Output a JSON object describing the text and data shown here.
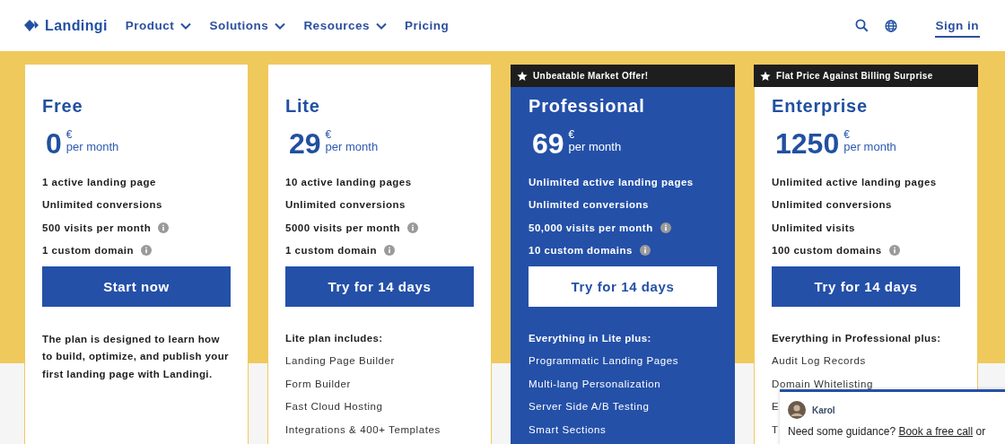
{
  "header": {
    "logo": "Landingi",
    "nav": [
      {
        "label": "Product",
        "dropdown": true
      },
      {
        "label": "Solutions",
        "dropdown": true
      },
      {
        "label": "Resources",
        "dropdown": true
      },
      {
        "label": "Pricing",
        "dropdown": false
      }
    ],
    "sign_in": "Sign in"
  },
  "plans": [
    {
      "name": "Free",
      "highlighted": false,
      "price": "0",
      "currency": "€",
      "period": "per month",
      "features": [
        {
          "text": "1 active landing page",
          "info": false
        },
        {
          "text": "Unlimited conversions",
          "info": false
        },
        {
          "text": "500 visits per month",
          "info": true
        },
        {
          "text": "1 custom domain",
          "info": true
        }
      ],
      "button": "Start now",
      "description": "The plan is designed to learn how to build, optimize, and publish your first landing page with Landingi."
    },
    {
      "name": "Lite",
      "highlighted": false,
      "price": "29",
      "currency": "€",
      "period": "per month",
      "features": [
        {
          "text": "10 active landing pages",
          "info": false
        },
        {
          "text": "Unlimited conversions",
          "info": false
        },
        {
          "text": "5000 visits per month",
          "info": true
        },
        {
          "text": "1 custom domain",
          "info": true
        }
      ],
      "button": "Try for 14 days",
      "includes_heading": "Lite plan includes:",
      "includes": [
        "Landing Page Builder",
        "Form Builder",
        "Fast Cloud Hosting",
        "Integrations & 400+ Templates"
      ]
    },
    {
      "name": "Professional",
      "ribbon": "Unbeatable Market Offer!",
      "highlighted": true,
      "price": "69",
      "currency": "€",
      "period": "per month",
      "features": [
        {
          "text": "Unlimited active landing pages",
          "info": false
        },
        {
          "text": "Unlimited conversions",
          "info": false
        },
        {
          "text": "50,000 visits per month",
          "info": true
        },
        {
          "text": "10 custom domains",
          "info": true
        }
      ],
      "button": "Try for 14 days",
      "includes_heading": "Everything in Lite plus:",
      "includes": [
        "Programmatic Landing Pages",
        "Multi-lang Personalization",
        "Server Side A/B Testing",
        "Smart Sections"
      ]
    },
    {
      "name": "Enterprise",
      "ribbon": "Flat Price Against Billing Surprise",
      "highlighted": false,
      "price": "1250",
      "currency": "€",
      "period": "per month",
      "features": [
        {
          "text": "Unlimited active landing pages",
          "info": false
        },
        {
          "text": "Unlimited conversions",
          "info": false
        },
        {
          "text": "Unlimited visits",
          "info": false
        },
        {
          "text": "100 custom domains",
          "info": true
        }
      ],
      "button": "Try for 14 days",
      "includes_heading": "Everything in Professional plus:",
      "includes": [
        "Audit Log Records",
        "Domain Whitelisting",
        "E",
        "T"
      ]
    }
  ],
  "chat": {
    "name": "Karol",
    "message": "Need some guidance?",
    "link": "Book a free call",
    "message_end": "or"
  }
}
